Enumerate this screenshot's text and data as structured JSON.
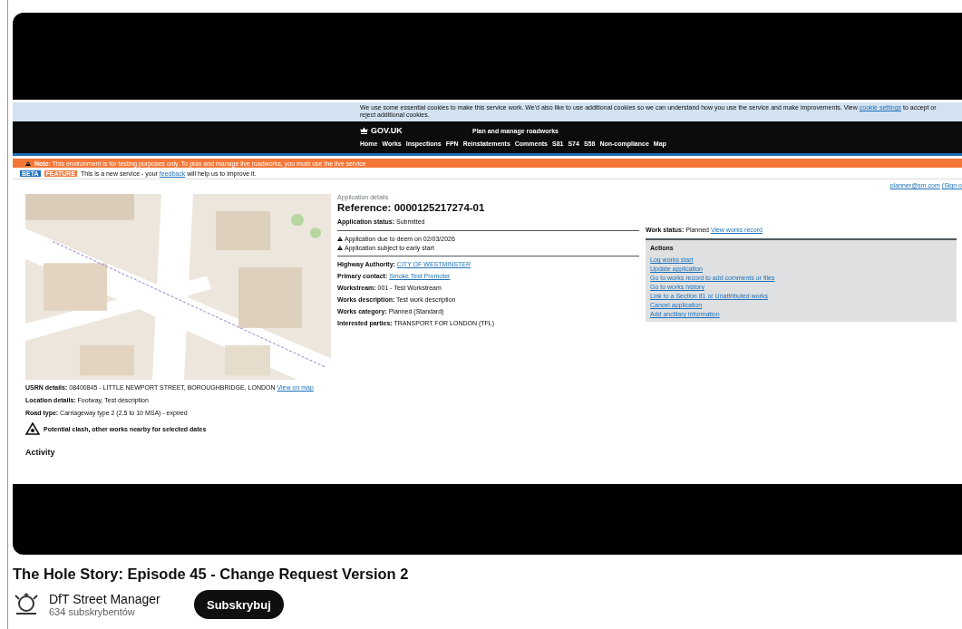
{
  "screen": {
    "cookie_banner": {
      "text": "We use some essential cookies to make this service work. We'd also like to use additional cookies so we can understand how you use the service and make improvements. View ",
      "link": "cookie settings",
      "text_after": " to accept or reject additional cookies."
    },
    "header": {
      "logo": "GOV.UK",
      "service": "Plan and manage roadworks",
      "nav": [
        "Home",
        "Works",
        "Inspections",
        "FPN",
        "Reinstatements",
        "Comments",
        "S81",
        "S74",
        "S58",
        "Non-compliance",
        "Map"
      ]
    },
    "notice": {
      "text": "**Note:** This environment is for testing purposes only. To plan and manage live roadworks, you must use the live service"
    },
    "phase": {
      "tags": [
        {
          "label": "BETA",
          "color": "#1d70b8"
        },
        {
          "label": "FEATURE",
          "color": "#f47738"
        }
      ],
      "text": "This is a new service - your ",
      "link": "feedback",
      "text_after": " will help us to improve it."
    },
    "user": {
      "email": "planner@sm.com",
      "sign_out": "(Sign o"
    },
    "location": {
      "fields": [
        {
          "text": "**USRN details:** 08400845 - LITTLE NEWPORT STREET, BOROUGHBRIDGE, LONDON ",
          "link": "View on map"
        },
        {
          "text": "**Location details:** Footway, Test description"
        },
        {
          "text": "**Road type:** Carriageway type 2 (2.5 to 10 MSA) - expired"
        }
      ],
      "clash": "Potential clash, other works nearby for selected dates"
    },
    "application": {
      "caption": "Application details",
      "reference": "Reference: 0000125217274-01",
      "status": "**Application status:** Submitted",
      "warnings": [
        "Application due to deem on 02/03/2026",
        "Application subject to early start"
      ],
      "fields": [
        {
          "text": "**Highway Authority:** ",
          "link": "CITY OF WESTMINSTER"
        },
        {
          "text": "**Primary contact:** ",
          "link": "Smoke Test Promoter"
        },
        {
          "text": "**Workstream:** 001 - Test Workstream"
        },
        {
          "text": "**Works description:** Test work description"
        },
        {
          "text": "**Works category:** Planned (Standard)"
        },
        {
          "text": "**Interested parties:** TRANSPORT FOR LONDON (TFL)"
        }
      ]
    },
    "work_status": {
      "text": "**Work status:** Planned ",
      "link": "View works record"
    },
    "actions": {
      "title": "Actions",
      "links": [
        "Log works start",
        "Update application",
        "Go to works record to add comments or files",
        "Go to works history",
        "Link to a Section 81 or Unattributed works",
        "Cancel application",
        "Add ancillary information"
      ]
    },
    "activity_heading": "Activity"
  },
  "video": {
    "title": "The Hole Story: Episode 45 - Change Request Version 2",
    "channel": "DfT Street Manager",
    "subscribers": "634 subskrybentów",
    "subscribe_button": "Subskrybuj"
  }
}
